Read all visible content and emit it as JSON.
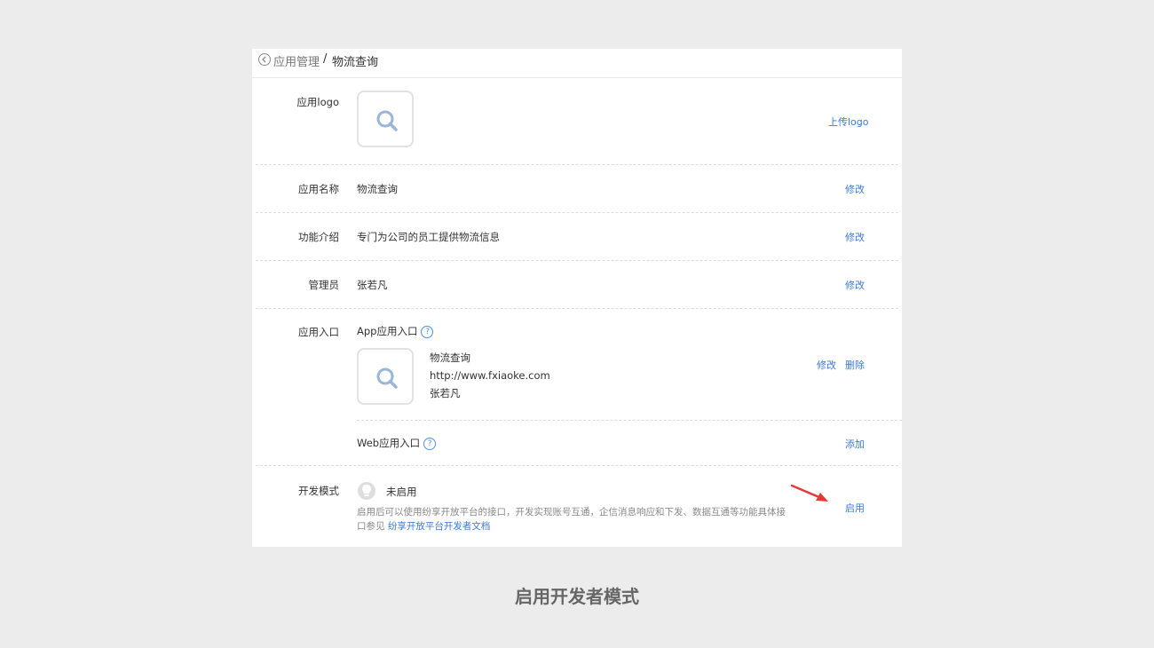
{
  "breadcrumb": {
    "parent": "应用管理",
    "separator": "/",
    "current": "物流查询"
  },
  "rows": {
    "logo": {
      "label": "应用logo",
      "action": "上传logo"
    },
    "name": {
      "label": "应用名称",
      "value": "物流查询",
      "action": "修改"
    },
    "intro": {
      "label": "功能介绍",
      "value": "专门为公司的员工提供物流信息",
      "action": "修改"
    },
    "admin": {
      "label": "管理员",
      "value": "张若凡",
      "action": "修改"
    },
    "entry": {
      "label": "应用入口",
      "app_title": "App应用入口",
      "app_name": "物流查询",
      "app_url": "http://www.fxiaoke.com",
      "app_admin": "张若凡",
      "edit": "修改",
      "delete": "删除",
      "web_title": "Web应用入口",
      "web_action": "添加",
      "help_glyph": "?"
    },
    "dev": {
      "label": "开发模式",
      "status": "未启用",
      "desc": "启用后可以使用纷享开放平台的接口，开发实现账号互通，企信消息响应和下发、数据互通等功能具体接口参见",
      "link": "纷享开放平台开发者文档",
      "action": "启用"
    }
  },
  "caption": "启用开发者模式",
  "colors": {
    "link": "#3a7bd5",
    "arrow": "#e53935",
    "background": "#ececec"
  },
  "icons": [
    "back-icon",
    "search-icon",
    "help-icon",
    "bulb-icon",
    "arrow-annotation"
  ]
}
